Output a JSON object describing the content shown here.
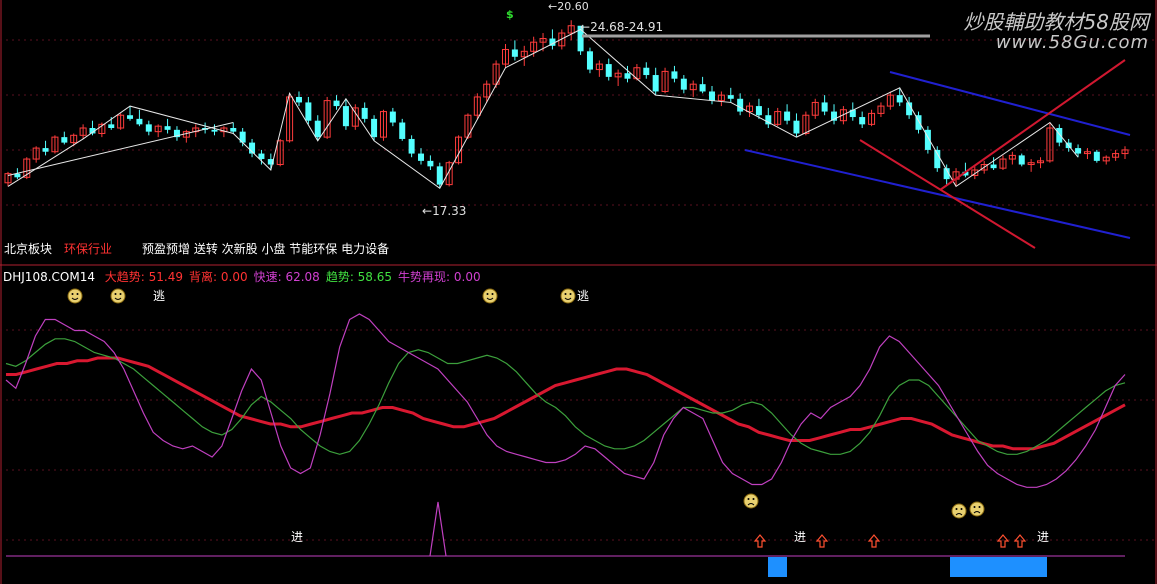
{
  "watermark": {
    "line1": "炒股輔助教材58股网",
    "line2": "www.58Gu.com"
  },
  "candles": {
    "low_label": "17.33",
    "high_label": "20.60",
    "range_label": "24.68-24.91"
  },
  "sectors": {
    "label": "北京板块",
    "industry": "环保行业",
    "concepts": "预盈预增 送转 次新股 小盘 节能环保 电力设备"
  },
  "indicator": {
    "name": "DHJ108.COM14",
    "values": [
      {
        "label": "大趋势:",
        "value": "51.49",
        "color": "#ff3232"
      },
      {
        "label": "背离:",
        "value": "0.00",
        "color": "#ff3232"
      },
      {
        "label": "快速:",
        "value": "62.08",
        "color": "#d040d0"
      },
      {
        "label": "趋势:",
        "value": "58.65",
        "color": "#40e040"
      },
      {
        "label": "牛势再现:",
        "value": "0.00",
        "color": "#d040d0"
      }
    ],
    "escape_label": "逃",
    "enter_label": "进"
  },
  "chart_data": [
    {
      "type": "candlestick",
      "price_labels": [
        "17.33",
        "20.60",
        "24.68-24.91"
      ],
      "candles": [
        [
          12.6,
          13.2,
          12.4,
          13.1
        ],
        [
          13.1,
          13.4,
          12.8,
          12.9
        ],
        [
          12.9,
          14.0,
          12.8,
          13.9
        ],
        [
          13.9,
          14.6,
          13.7,
          14.5
        ],
        [
          14.5,
          14.9,
          14.1,
          14.3
        ],
        [
          14.3,
          15.2,
          14.2,
          15.1
        ],
        [
          15.1,
          15.4,
          14.7,
          14.8
        ],
        [
          14.8,
          15.3,
          14.6,
          15.2
        ],
        [
          15.2,
          15.8,
          15.0,
          15.6
        ],
        [
          15.6,
          16.0,
          15.2,
          15.3
        ],
        [
          15.3,
          15.9,
          15.1,
          15.8
        ],
        [
          15.8,
          16.2,
          15.5,
          15.6
        ],
        [
          15.6,
          16.4,
          15.5,
          16.3
        ],
        [
          16.3,
          16.8,
          16.0,
          16.1
        ],
        [
          16.1,
          16.6,
          15.7,
          15.8
        ],
        [
          15.8,
          16.0,
          15.2,
          15.4
        ],
        [
          15.4,
          15.8,
          15.1,
          15.7
        ],
        [
          15.7,
          16.1,
          15.3,
          15.5
        ],
        [
          15.5,
          15.7,
          14.9,
          15.1
        ],
        [
          15.1,
          15.5,
          14.8,
          15.4
        ],
        [
          15.4,
          15.8,
          15.1,
          15.6
        ],
        [
          15.6,
          15.9,
          15.3,
          15.5
        ],
        [
          15.5,
          15.8,
          15.2,
          15.4
        ],
        [
          15.4,
          15.7,
          15.1,
          15.6
        ],
        [
          15.6,
          15.9,
          15.3,
          15.4
        ],
        [
          15.4,
          15.6,
          14.6,
          14.8
        ],
        [
          14.8,
          15.0,
          14.0,
          14.2
        ],
        [
          14.2,
          14.4,
          13.6,
          13.9
        ],
        [
          13.9,
          14.2,
          13.3,
          13.6
        ],
        [
          13.6,
          15.0,
          13.5,
          14.9
        ],
        [
          14.9,
          17.5,
          14.8,
          17.3
        ],
        [
          17.3,
          17.6,
          16.8,
          17.0
        ],
        [
          17.0,
          17.3,
          15.8,
          16.0
        ],
        [
          16.0,
          16.3,
          14.9,
          15.1
        ],
        [
          15.1,
          17.3,
          15.0,
          17.1
        ],
        [
          17.1,
          17.4,
          16.6,
          16.8
        ],
        [
          16.8,
          17.2,
          15.5,
          15.7
        ],
        [
          15.7,
          16.9,
          15.5,
          16.7
        ],
        [
          16.7,
          17.0,
          15.9,
          16.1
        ],
        [
          16.1,
          16.3,
          14.9,
          15.1
        ],
        [
          15.1,
          16.6,
          14.9,
          16.5
        ],
        [
          16.5,
          16.7,
          15.7,
          15.9
        ],
        [
          15.9,
          16.1,
          14.9,
          15.0
        ],
        [
          15.0,
          15.2,
          14.0,
          14.2
        ],
        [
          14.2,
          14.5,
          13.6,
          13.8
        ],
        [
          13.8,
          14.1,
          13.3,
          13.5
        ],
        [
          13.5,
          13.7,
          12.3,
          12.5
        ],
        [
          12.5,
          13.8,
          12.4,
          13.7
        ],
        [
          13.7,
          15.2,
          13.6,
          15.1
        ],
        [
          15.1,
          16.4,
          15.0,
          16.3
        ],
        [
          16.3,
          17.5,
          16.1,
          17.3
        ],
        [
          17.3,
          18.2,
          17.0,
          18.0
        ],
        [
          18.0,
          19.3,
          17.8,
          19.1
        ],
        [
          19.1,
          20.2,
          18.9,
          19.9
        ],
        [
          19.9,
          20.4,
          19.3,
          19.5
        ],
        [
          19.5,
          20.1,
          19.0,
          19.8
        ],
        [
          19.8,
          20.6,
          19.5,
          20.3
        ],
        [
          20.3,
          20.8,
          19.8,
          20.5
        ],
        [
          20.5,
          21.0,
          19.9,
          20.1
        ],
        [
          20.1,
          21.0,
          19.9,
          20.8
        ],
        [
          20.8,
          21.5,
          20.4,
          21.2
        ],
        [
          21.2,
          21.0,
          19.6,
          19.8
        ],
        [
          19.8,
          20.0,
          18.6,
          18.8
        ],
        [
          18.8,
          19.3,
          18.4,
          19.1
        ],
        [
          19.1,
          19.4,
          18.2,
          18.4
        ],
        [
          18.4,
          18.8,
          17.9,
          18.6
        ],
        [
          18.6,
          19.0,
          18.1,
          18.3
        ],
        [
          18.3,
          19.1,
          18.2,
          18.9
        ],
        [
          18.9,
          19.2,
          18.3,
          18.5
        ],
        [
          18.5,
          18.9,
          17.4,
          17.6
        ],
        [
          17.6,
          18.9,
          17.5,
          18.7
        ],
        [
          18.7,
          19.0,
          18.1,
          18.3
        ],
        [
          18.3,
          18.5,
          17.5,
          17.7
        ],
        [
          17.7,
          18.2,
          17.3,
          18.0
        ],
        [
          18.0,
          18.4,
          17.5,
          17.6
        ],
        [
          17.6,
          17.9,
          16.9,
          17.1
        ],
        [
          17.1,
          17.6,
          16.8,
          17.4
        ],
        [
          17.4,
          17.8,
          17.0,
          17.2
        ],
        [
          17.2,
          17.5,
          16.3,
          16.5
        ],
        [
          16.5,
          17.0,
          16.2,
          16.8
        ],
        [
          16.8,
          17.2,
          16.1,
          16.3
        ],
        [
          16.3,
          16.7,
          15.6,
          15.8
        ],
        [
          15.8,
          16.7,
          15.7,
          16.5
        ],
        [
          16.5,
          16.9,
          15.8,
          16.0
        ],
        [
          16.0,
          16.4,
          15.1,
          15.3
        ],
        [
          15.3,
          16.5,
          15.2,
          16.3
        ],
        [
          16.3,
          17.2,
          16.1,
          17.0
        ],
        [
          17.0,
          17.4,
          16.3,
          16.5
        ],
        [
          16.5,
          16.9,
          15.8,
          16.0
        ],
        [
          16.0,
          16.8,
          15.8,
          16.6
        ],
        [
          16.6,
          17.0,
          16.0,
          16.2
        ],
        [
          16.2,
          16.5,
          15.6,
          15.8
        ],
        [
          15.8,
          16.6,
          15.7,
          16.4
        ],
        [
          16.4,
          17.0,
          16.2,
          16.8
        ],
        [
          16.8,
          17.6,
          16.6,
          17.4
        ],
        [
          17.4,
          17.8,
          16.8,
          17.0
        ],
        [
          17.0,
          17.3,
          16.1,
          16.3
        ],
        [
          16.3,
          16.5,
          15.3,
          15.5
        ],
        [
          15.5,
          15.7,
          14.2,
          14.4
        ],
        [
          14.4,
          14.6,
          13.2,
          13.4
        ],
        [
          13.4,
          13.6,
          12.5,
          12.8
        ],
        [
          12.8,
          13.4,
          12.4,
          13.2
        ],
        [
          13.2,
          13.7,
          12.9,
          13.0
        ],
        [
          13.0,
          13.5,
          12.8,
          13.3
        ],
        [
          13.3,
          13.8,
          13.1,
          13.6
        ],
        [
          13.6,
          14.0,
          13.3,
          13.4
        ],
        [
          13.4,
          14.1,
          13.3,
          13.9
        ],
        [
          13.9,
          14.3,
          13.6,
          14.1
        ],
        [
          14.1,
          14.2,
          13.5,
          13.6
        ],
        [
          13.6,
          13.9,
          13.2,
          13.7
        ],
        [
          13.7,
          14.0,
          13.4,
          13.8
        ],
        [
          13.8,
          15.9,
          13.7,
          15.6
        ],
        [
          15.6,
          15.8,
          14.6,
          14.8
        ],
        [
          14.8,
          15.0,
          14.3,
          14.5
        ],
        [
          14.5,
          14.7,
          14.0,
          14.2
        ],
        [
          14.2,
          14.5,
          13.9,
          14.3
        ],
        [
          14.3,
          14.4,
          13.7,
          13.8
        ],
        [
          13.8,
          14.1,
          13.6,
          14.0
        ],
        [
          14.0,
          14.4,
          13.8,
          14.2
        ],
        [
          14.2,
          14.6,
          13.9,
          14.4
        ]
      ]
    },
    {
      "type": "line",
      "series": [
        {
          "name": "大趋势",
          "color": "#d81830",
          "values": [
            62,
            62,
            63,
            64,
            65,
            66,
            66,
            67,
            67,
            68,
            68,
            68,
            67,
            66,
            65,
            63,
            61,
            59,
            57,
            55,
            53,
            51,
            49,
            47,
            46,
            45,
            44,
            44,
            43,
            43,
            44,
            45,
            46,
            47,
            48,
            48,
            49,
            50,
            50,
            49,
            48,
            46,
            45,
            44,
            43,
            43,
            44,
            45,
            46,
            48,
            50,
            52,
            54,
            56,
            58,
            59,
            60,
            61,
            62,
            63,
            64,
            64,
            63,
            62,
            60,
            58,
            56,
            54,
            52,
            50,
            48,
            46,
            44,
            43,
            41,
            40,
            39,
            38,
            38,
            38,
            39,
            40,
            41,
            42,
            42,
            43,
            44,
            45,
            46,
            46,
            45,
            44,
            42,
            40,
            39,
            38,
            37,
            36,
            36,
            35,
            35,
            35,
            36,
            37,
            39,
            41,
            43,
            45,
            47,
            49,
            51
          ]
        },
        {
          "name": "趋势",
          "color": "#3ca03c",
          "values": [
            66,
            65,
            67,
            70,
            73,
            75,
            75,
            74,
            72,
            70,
            69,
            68,
            66,
            64,
            61,
            58,
            55,
            52,
            49,
            46,
            43,
            41,
            40,
            42,
            46,
            51,
            54,
            52,
            49,
            46,
            42,
            39,
            36,
            34,
            33,
            34,
            38,
            44,
            51,
            59,
            66,
            70,
            71,
            70,
            68,
            66,
            66,
            67,
            68,
            69,
            68,
            66,
            63,
            59,
            55,
            52,
            50,
            47,
            43,
            40,
            38,
            36,
            35,
            35,
            36,
            38,
            41,
            44,
            47,
            50,
            50,
            49,
            48,
            48,
            49,
            51,
            52,
            51,
            48,
            44,
            40,
            37,
            35,
            34,
            33,
            33,
            34,
            37,
            41,
            47,
            54,
            58,
            60,
            60,
            58,
            54,
            50,
            46,
            42,
            38,
            36,
            34,
            33,
            33,
            34,
            36,
            38,
            41,
            44,
            47,
            50,
            53,
            56,
            58,
            59
          ]
        },
        {
          "name": "快速",
          "color": "#c040c0",
          "values": [
            60,
            57,
            66,
            76,
            82,
            82,
            80,
            78,
            78,
            76,
            74,
            70,
            64,
            56,
            48,
            41,
            38,
            36,
            35,
            36,
            34,
            32,
            36,
            46,
            56,
            64,
            60,
            48,
            36,
            28,
            26,
            28,
            40,
            55,
            72,
            82,
            84,
            82,
            78,
            74,
            72,
            70,
            68,
            66,
            64,
            60,
            56,
            52,
            46,
            40,
            36,
            34,
            33,
            32,
            31,
            30,
            30,
            31,
            33,
            36,
            35,
            32,
            29,
            26,
            25,
            24,
            30,
            40,
            46,
            50,
            48,
            46,
            38,
            30,
            26,
            24,
            22,
            22,
            24,
            30,
            38,
            44,
            48,
            46,
            50,
            52,
            54,
            58,
            64,
            72,
            76,
            74,
            70,
            66,
            62,
            58,
            52,
            46,
            40,
            34,
            29,
            26,
            24,
            22,
            21,
            21,
            22,
            24,
            27,
            31,
            36,
            42,
            50,
            58,
            62
          ]
        }
      ]
    }
  ]
}
